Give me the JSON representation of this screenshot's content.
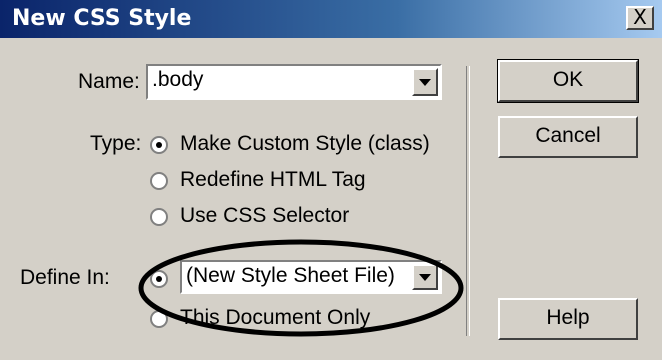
{
  "window": {
    "title": "New CSS Style",
    "close_label": "X"
  },
  "name": {
    "label": "Name:",
    "value": ".body"
  },
  "type": {
    "label": "Type:",
    "options": [
      {
        "label": "Make Custom Style (class)",
        "selected": true
      },
      {
        "label": "Redefine HTML Tag",
        "selected": false
      },
      {
        "label": "Use CSS Selector",
        "selected": false
      }
    ]
  },
  "define_in": {
    "label": "Define In:",
    "options": [
      {
        "label": "(New Style Sheet File)",
        "selected": true
      },
      {
        "label": "This Document Only",
        "selected": false
      }
    ]
  },
  "buttons": {
    "ok": "OK",
    "cancel": "Cancel",
    "help": "Help"
  },
  "annotation": {
    "color": "#000000"
  }
}
